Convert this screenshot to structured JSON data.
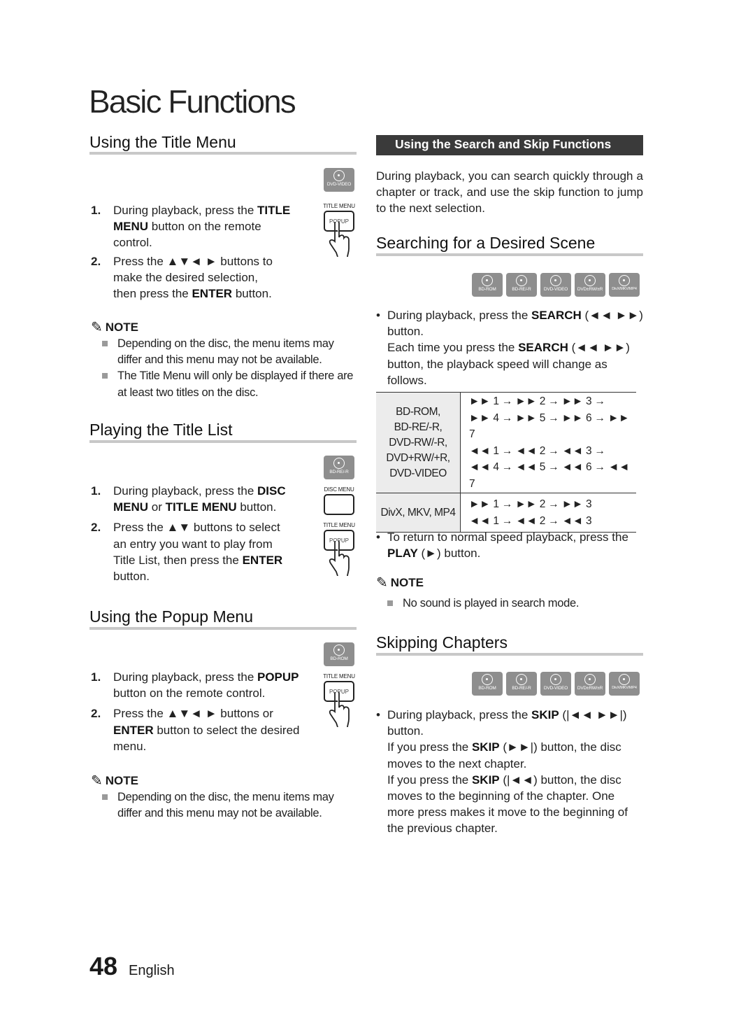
{
  "page_title": "Basic Functions",
  "left": {
    "title_menu": {
      "heading": "Using the Title Menu",
      "badge": "DVD-VIDEO",
      "remote_label": "TITLE MENU",
      "remote_button": "POPUP",
      "steps": [
        {
          "num": "1.",
          "parts": [
            "During playback, press the ",
            "TITLE MENU",
            " button on the remote control."
          ]
        },
        {
          "num": "2.",
          "parts": [
            "Press the ▲▼◄ ► buttons to make the desired selection, then press the ",
            "ENTER",
            " button."
          ]
        }
      ],
      "note_label": "NOTE",
      "notes": [
        "Depending on the disc, the menu items may differ and this menu may not be available.",
        "The Title Menu will only be displayed if there are at least two titles on the disc."
      ]
    },
    "title_list": {
      "heading": "Playing the Title List",
      "badge": "BD-RE/-R",
      "remote_label_1": "DISC MENU",
      "remote_label_2": "TITLE MENU",
      "remote_button": "POPUP",
      "steps": [
        {
          "num": "1.",
          "parts": [
            "During playback, press the ",
            "DISC MENU",
            " or ",
            "TITLE MENU",
            " button."
          ]
        },
        {
          "num": "2.",
          "parts": [
            "Press the ▲▼ buttons to select an entry you want to play from Title List, then press the ",
            "ENTER",
            " button."
          ]
        }
      ]
    },
    "popup_menu": {
      "heading": "Using the Popup Menu",
      "badge": "BD-ROM",
      "remote_label": "TITLE MENU",
      "remote_button": "POPUP",
      "steps": [
        {
          "num": "1.",
          "parts": [
            "During playback, press the ",
            "POPUP",
            " button on the remote control."
          ]
        },
        {
          "num": "2.",
          "parts": [
            "Press the ▲▼◄ ► buttons or ",
            "ENTER",
            " button to select the desired menu."
          ]
        }
      ],
      "note_label": "NOTE",
      "notes": [
        "Depending on the disc, the menu items may differ and this menu may not be available."
      ]
    }
  },
  "right": {
    "section_bar": "Using the Search and Skip Functions",
    "intro": "During playback, you can search quickly through a chapter or track, and use the skip function to jump to the next selection.",
    "search": {
      "heading": "Searching for a Desired Scene",
      "badges": [
        "BD-ROM",
        "BD-RE/-R",
        "DVD-VIDEO",
        "DVD±RW/±R",
        "DivX/MKV/MP4"
      ],
      "bullet_parts": [
        "During playback, press the ",
        "SEARCH",
        " (◄◄ ►►) button."
      ],
      "followup_parts": [
        "Each time you press the ",
        "SEARCH",
        " (◄◄ ►►) button, the playback speed will change as follows."
      ],
      "table": [
        {
          "media": [
            "BD-ROM,",
            "BD-RE/-R,",
            "DVD-RW/-R,",
            "DVD+RW/+R,",
            "DVD-VIDEO"
          ],
          "sequence": [
            "►► 1 → ►► 2 → ►► 3 →",
            "►► 4 → ►► 5 → ►► 6 → ►► 7",
            "◄◄ 1 → ◄◄ 2 → ◄◄ 3 →",
            "◄◄ 4 → ◄◄ 5 → ◄◄ 6 → ◄◄ 7"
          ]
        },
        {
          "media": [
            "DivX, MKV, MP4"
          ],
          "sequence": [
            "►► 1 → ►► 2 → ►► 3",
            "◄◄ 1 → ◄◄ 2 → ◄◄ 3"
          ]
        }
      ],
      "return_parts": [
        "To return to normal speed playback, press the ",
        "PLAY",
        " (►) button."
      ],
      "note_label": "NOTE",
      "notes": [
        "No sound is played in search mode."
      ]
    },
    "skip": {
      "heading": "Skipping Chapters",
      "badges": [
        "BD-ROM",
        "BD-RE/-R",
        "DVD-VIDEO",
        "DVD±RW/±R",
        "DivX/MKV/MP4"
      ],
      "bullet_parts": [
        "During playback, press the ",
        "SKIP",
        " (|◄◄ ►►|) button."
      ],
      "next_parts": [
        "If you press the ",
        "SKIP",
        " (►►|) button, the disc moves to the next chapter."
      ],
      "prev_parts": [
        "If you press the ",
        "SKIP",
        " (|◄◄) button, the disc moves to the beginning of the chapter. One more press makes it move to the beginning of the previous chapter."
      ]
    }
  },
  "footer": {
    "page_number": "48",
    "language": "English"
  }
}
